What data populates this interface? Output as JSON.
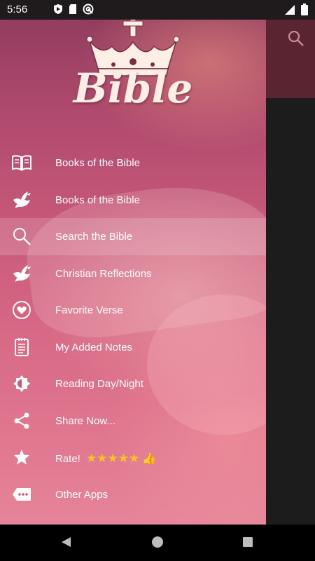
{
  "status_bar": {
    "time": "5:56",
    "left_icons": [
      "shield-icon",
      "sd-card-icon",
      "at-sign-icon"
    ],
    "right_icons": [
      "signal-icon",
      "battery-icon"
    ]
  },
  "drawer": {
    "logo_title": "Bible",
    "menu": [
      {
        "label": "Books of the Bible",
        "icon": "open-book-icon",
        "active": false
      },
      {
        "label": "Books of the Bible",
        "icon": "dove-icon",
        "active": false
      },
      {
        "label": "Search the Bible",
        "icon": "search-icon",
        "active": true
      },
      {
        "label": "Christian Reflections",
        "icon": "dove-icon",
        "active": false
      },
      {
        "label": "Favorite Verse",
        "icon": "heart-icon",
        "active": false
      },
      {
        "label": "My Added Notes",
        "icon": "notepad-icon",
        "active": false
      },
      {
        "label": "Reading Day/Night",
        "icon": "brightness-icon",
        "active": false
      },
      {
        "label": "Share Now...",
        "icon": "share-icon",
        "active": false
      },
      {
        "label": "Rate!",
        "icon": "star-icon",
        "active": false,
        "suffix_stars": "★★★★★",
        "suffix_thumb": "👍"
      },
      {
        "label": "Other Apps",
        "icon": "more-apps-icon",
        "active": false
      }
    ]
  },
  "app_bar": {
    "search_icon": "search-icon"
  },
  "nav_bar": {
    "buttons": [
      "back-icon",
      "home-icon",
      "recents-icon"
    ]
  },
  "colors": {
    "drawer_top": "#8c3a5c",
    "drawer_bottom": "#e6849a",
    "toolbar": "#5a2430",
    "star": "#f7c51e"
  }
}
